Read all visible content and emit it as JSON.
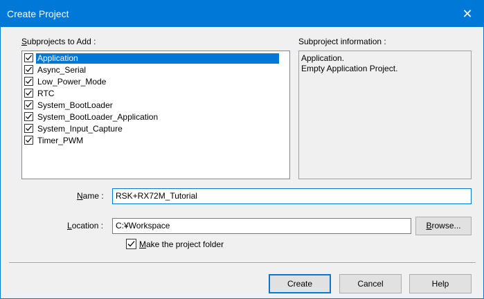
{
  "window": {
    "title": "Create Project",
    "close_glyph": "✕"
  },
  "subprojects": {
    "label_prefix": "",
    "label_mnemonic": "S",
    "label_rest": "ubprojects to Add :",
    "items": [
      {
        "label": "Application",
        "checked": true,
        "selected": true
      },
      {
        "label": "Async_Serial",
        "checked": true,
        "selected": false
      },
      {
        "label": "Low_Power_Mode",
        "checked": true,
        "selected": false
      },
      {
        "label": "RTC",
        "checked": true,
        "selected": false
      },
      {
        "label": "System_BootLoader",
        "checked": true,
        "selected": false
      },
      {
        "label": "System_BootLoader_Application",
        "checked": true,
        "selected": false
      },
      {
        "label": "System_Input_Capture",
        "checked": true,
        "selected": false
      },
      {
        "label": "Timer_PWM",
        "checked": true,
        "selected": false
      }
    ]
  },
  "info": {
    "label": "Subproject information :",
    "line1": "Application.",
    "line2": "Empty Application Project."
  },
  "name_field": {
    "label_mnemonic": "N",
    "label_rest": "ame :",
    "value": "RSK+RX72M_Tutorial"
  },
  "location_field": {
    "label_mnemonic": "L",
    "label_rest": "ocation :",
    "value": "C:¥Workspace",
    "browse_mnemonic": "B",
    "browse_rest": "rowse..."
  },
  "make_folder": {
    "checked": true,
    "label_mnemonic": "M",
    "label_rest": "ake the project folder"
  },
  "buttons": {
    "create": "Create",
    "cancel": "Cancel",
    "help": "Help"
  },
  "colors": {
    "accent": "#0078d7",
    "dialog_bg": "#f0f0f0",
    "button_face": "#e1e1e1"
  },
  "icons": {
    "close": "close-icon",
    "check": "check-icon"
  }
}
